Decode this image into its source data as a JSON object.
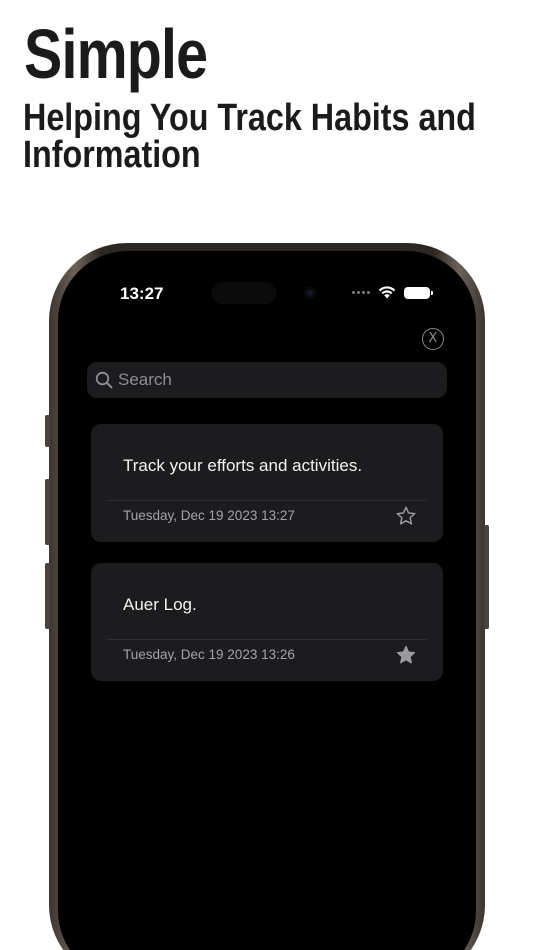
{
  "promo": {
    "headline": "Simple",
    "subheadline": "Helping You Track Habits and Information"
  },
  "status_bar": {
    "time": "13:27"
  },
  "close_button": {
    "icon": "close-x-icon",
    "label": "X"
  },
  "search": {
    "placeholder": "Search",
    "icon": "search-icon"
  },
  "entries": [
    {
      "text": "Track your efforts and activities.",
      "date": "Tuesday, Dec 19 2023 13:27",
      "starred": false,
      "star_icon": "star-outline-icon"
    },
    {
      "text": "Auer Log.",
      "date": "Tuesday, Dec 19 2023 13:26",
      "starred": true,
      "star_icon": "star-filled-icon"
    }
  ],
  "colors": {
    "screen_background": "#000000",
    "card_background": "#1c1c1e",
    "star": "#9a9aa0"
  }
}
